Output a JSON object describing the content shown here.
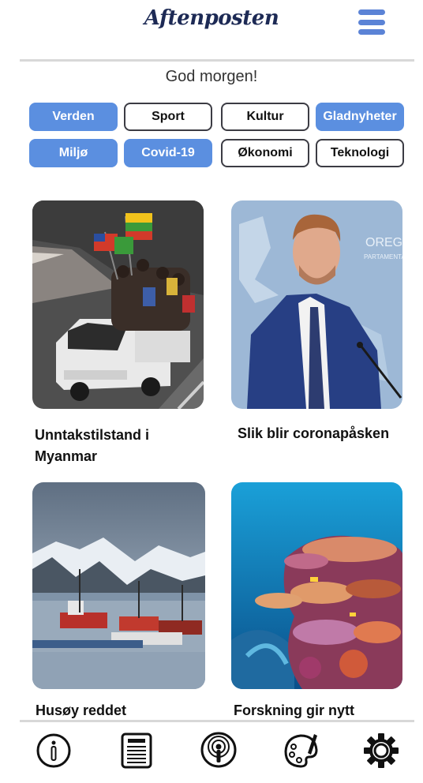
{
  "header": {
    "logo_text": "Aftenposten"
  },
  "greeting": "God morgen!",
  "categories": [
    {
      "label": "Verden",
      "active": true
    },
    {
      "label": "Sport",
      "active": false
    },
    {
      "label": "Kultur",
      "active": false
    },
    {
      "label": "Gladnyheter",
      "active": true
    },
    {
      "label": "Miljø",
      "active": true
    },
    {
      "label": "Covid-19",
      "active": true
    },
    {
      "label": "Økonomi",
      "active": false
    },
    {
      "label": "Teknologi",
      "active": false
    }
  ],
  "articles": [
    {
      "title": "Unntakstilstand i Myanmar",
      "image": "myanmar-protest-truck-photo"
    },
    {
      "title": "Slik blir coronapåsken",
      "image": "health-minister-press-conference-photo"
    },
    {
      "title": "Husøy reddet",
      "image": "husoy-harbor-mountains-photo"
    },
    {
      "title": "Forskning gir nytt",
      "image": "coral-reef-photo"
    }
  ],
  "bottom_nav": [
    {
      "name": "info-icon"
    },
    {
      "name": "newspaper-icon"
    },
    {
      "name": "podcast-icon"
    },
    {
      "name": "palette-icon"
    },
    {
      "name": "settings-gear-icon"
    }
  ],
  "colors": {
    "accent": "#5b8fe0",
    "logo": "#1d2a55",
    "menu": "#5b83d6"
  }
}
